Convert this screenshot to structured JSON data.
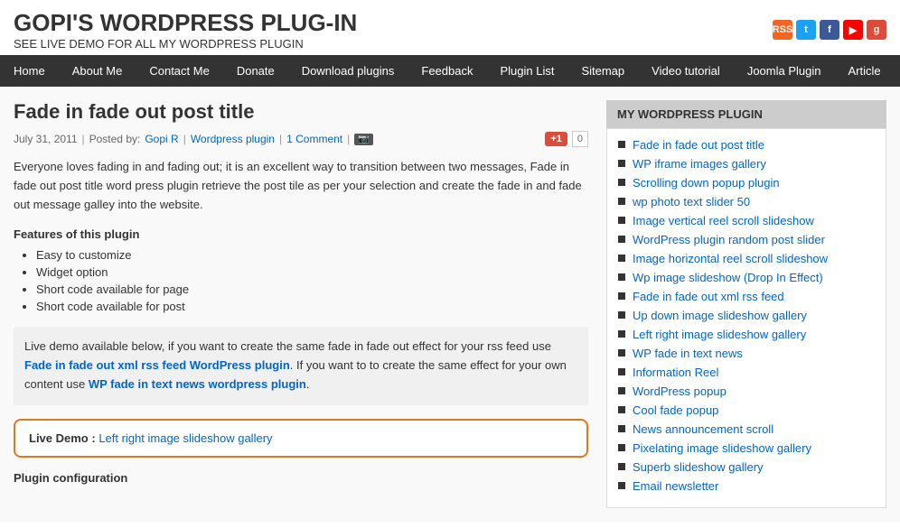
{
  "header": {
    "title": "GOPI'S WORDPRESS PLUG-IN",
    "subtitle": "SEE LIVE DEMO FOR ALL MY WORDPRESS PLUGIN"
  },
  "social_icons": [
    {
      "name": "rss-icon",
      "label": "RSS",
      "color": "#f26522"
    },
    {
      "name": "twitter-icon",
      "label": "t",
      "color": "#1da1f2"
    },
    {
      "name": "facebook-icon",
      "label": "f",
      "color": "#3b5998"
    },
    {
      "name": "youtube-icon",
      "label": "▶",
      "color": "#ff0000"
    },
    {
      "name": "google-icon",
      "label": "g",
      "color": "#dd4b39"
    }
  ],
  "nav": {
    "items": [
      {
        "label": "Home"
      },
      {
        "label": "About Me"
      },
      {
        "label": "Contact Me"
      },
      {
        "label": "Donate"
      },
      {
        "label": "Download plugins"
      },
      {
        "label": "Feedback"
      },
      {
        "label": "Plugin List"
      },
      {
        "label": "Sitemap"
      },
      {
        "label": "Video tutorial"
      },
      {
        "label": "Joomla Plugin"
      },
      {
        "label": "Article"
      }
    ]
  },
  "post": {
    "title": "Fade in fade out post title",
    "meta": {
      "date": "July 31, 2011",
      "posted_by": "Posted by:",
      "author": "Gopi R",
      "category": "Wordpress plugin",
      "comments": "1 Comment",
      "separators": [
        "|",
        "|",
        "|"
      ]
    },
    "body": "Everyone loves fading in and fading out; it is an excellent way to transition between two messages, Fade in fade out post title word press plugin retrieve the post tile as per your selection and create the fade in and fade out message galley into the website.",
    "features_title": "Features of this plugin",
    "features": [
      "Easy to customize",
      "Widget option",
      "Short code available for page",
      "Short code available for post"
    ],
    "info_box": {
      "prefix": "Live demo available below, if you want to create the same fade in fade out effect for your rss feed use ",
      "bold1": "Fade in fade out xml rss feed WordPress plugin",
      "middle": ". If you want to to create the same effect for your own content use ",
      "bold2": "WP fade in text news wordpress plugin",
      "suffix": "."
    },
    "live_demo": {
      "label": "Live Demo :",
      "text": "Left right image slideshow gallery"
    },
    "plugin_config_title": "Plugin configuration"
  },
  "sidebar": {
    "title": "MY WORDPRESS PLUGIN",
    "items": [
      "Fade in fade out post title",
      "WP iframe images gallery",
      "Scrolling down popup plugin",
      "wp photo text slider 50",
      "Image vertical reel scroll slideshow",
      "WordPress plugin random post slider",
      "Image horizontal reel scroll slideshow",
      "Wp image slideshow (Drop In Effect)",
      "Fade in fade out xml rss feed",
      "Up down image slideshow gallery",
      "Left right image slideshow gallery",
      "WP fade in text news",
      "Information Reel",
      "WordPress popup",
      "Cool fade popup",
      "News announcement scroll",
      "Pixelating image slideshow gallery",
      "Superb slideshow gallery",
      "Email newsletter"
    ]
  },
  "gplus": {
    "label": "+1",
    "count": "0"
  }
}
